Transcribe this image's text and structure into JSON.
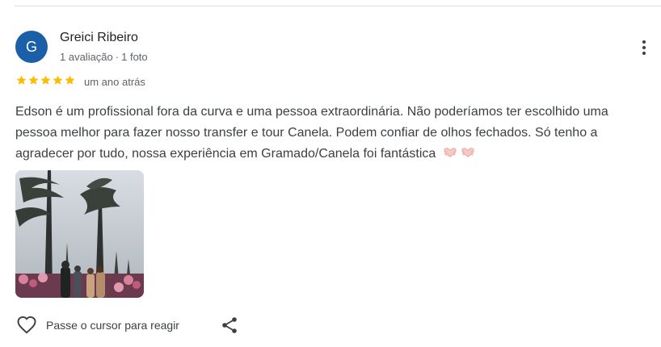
{
  "review": {
    "author_initial": "G",
    "author_name": "Greici Ribeiro",
    "review_count": "1 avaliação",
    "separator": "·",
    "photo_count": "1 foto",
    "rating": 5,
    "time_ago": "um ano atrás",
    "text": "Edson é um profissional fora da curva e uma pessoa extraordinária. Não poderíamos ter escolhido uma pessoa melhor para fazer nosso transfer e tour Canela. Podem confiar de olhos fechados. Só tenho a agradecer por tudo, nossa experiência em Gramado/Canela foi fantástica",
    "emojis": [
      "heart-hands",
      "heart-hands"
    ]
  },
  "actions": {
    "react_label": "Passe o cursor para reagir"
  },
  "colors": {
    "avatar_bg": "#1a5fa8",
    "star": "#fbbc04",
    "text_secondary": "#5f6368"
  },
  "icons": [
    "more-vert-icon",
    "star-icon",
    "heart-outline-icon",
    "share-icon",
    "heart-hands-emoji"
  ]
}
